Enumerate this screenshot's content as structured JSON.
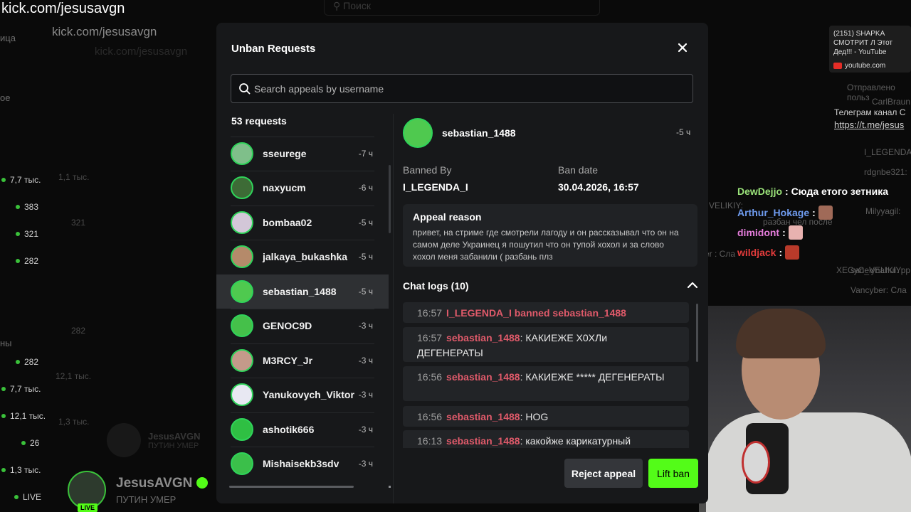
{
  "background": {
    "url_overlay": "kick.com/jesusavgn",
    "url_bar": "kick.com/jesusavgn",
    "url_bar_faint": "kick.com/jesusavgn",
    "search_placeholder": "Поиск",
    "left_labels": [
      "ица",
      "ое",
      "ны"
    ],
    "stats": [
      "7,7 тыс.",
      "383",
      "321",
      "282",
      "282",
      "7,7 тыс.",
      "12,1 тыс.",
      "26",
      "1,3 тыс.",
      "LIVE"
    ],
    "faint_stats": [
      "1,1 тыс.",
      "321",
      "282",
      "12,1 тыс.",
      "1,3 тыс."
    ],
    "channel_name": "JesusAVGN",
    "channel_subtitle": "ПУТИН УМЕР",
    "live_badge": "LIVE",
    "ghost_name": "JesusAVGN",
    "ghost_sub": "ПУТИН УМЕР"
  },
  "modal": {
    "title": "Unban Requests",
    "search_placeholder": "Search appeals by username",
    "request_count": "53 requests",
    "requests": [
      {
        "username": "sseurege",
        "time": "-7 ч",
        "color": "#7fbf8a"
      },
      {
        "username": "naxyucm",
        "time": "-6 ч",
        "color": "#3d6b36"
      },
      {
        "username": "bombaa02",
        "time": "-5 ч",
        "color": "#d3c7d8"
      },
      {
        "username": "jalkaya_bukashka",
        "time": "-5 ч",
        "color": "#b58a6a"
      },
      {
        "username": "sebastian_1488",
        "time": "-5 ч",
        "color": "#4fc94f"
      },
      {
        "username": "GENOC9D",
        "time": "-3 ч",
        "color": "#45c04a"
      },
      {
        "username": "M3RCY_Jr",
        "time": "-3 ч",
        "color": "#c49a8a"
      },
      {
        "username": "Yanukovych_Viktor",
        "time": "-3 ч",
        "color": "#e8e8f2"
      },
      {
        "username": "ashotik666",
        "time": "-3 ч",
        "color": "#2fbf43"
      },
      {
        "username": "Mishaisekb3sdv",
        "time": "-3 ч",
        "color": "#3bbf4a"
      }
    ],
    "selected": {
      "username": "sebastian_1488",
      "time": "-5 ч",
      "banned_by_label": "Banned By",
      "banned_by": "I_LEGENDA_I",
      "ban_date_label": "Ban date",
      "ban_date": "30.04.2026, 16:57",
      "appeal_reason_label": "Appeal reason",
      "appeal_reason": "привет, на стриме где смотрели лагоду и он рассказывал что он на самом деле Украинец я пошутил что он тупой хохол и за слово хохол меня забанили ( разбань плз",
      "chat_logs_label": "Chat logs (10)",
      "logs": [
        {
          "time": "16:57",
          "user": "",
          "text": "I_LEGENDA_I banned sebastian_1488",
          "system": true
        },
        {
          "time": "16:57",
          "user": "sebastian_1488",
          "text": ": КАКИЕЖЕ Х0ХЛи ДЕГЕНЕРАТЫ",
          "system": false
        },
        {
          "time": "16:56",
          "user": "sebastian_1488",
          "text": ": КАКИЕЖЕ ***** ДЕГЕНЕРАТЫ",
          "system": false
        },
        {
          "time": "16:56",
          "user": "sebastian_1488",
          "text": ": HOG",
          "system": false
        },
        {
          "time": "16:13",
          "user": "sebastian_1488",
          "text": ": какойже карикатурный",
          "system": false
        }
      ]
    },
    "reject_label": "Reject appeal",
    "lift_label": "Lift ban"
  },
  "chat": {
    "youtube_card": {
      "title": "(2151) SHAPKA СМОТРИТ Л Этот Дед!!! - YouTube",
      "source": "youtube.com"
    },
    "faint_lines": [
      "Отправлено польз",
      "CarlBraun",
      "Телеграм канал С",
      "https://t.me/jesus",
      "I_LEGENDA",
      "rdgnbe321:",
      "Milyyagil:",
      "разбан чел после",
      "XECyC_VELIKIY: р",
      "sanelynahui: р",
      "Vancyber: Сла",
      "VELIKIY: ",
      "er : Сла"
    ],
    "messages": [
      {
        "user": "DewDejjo",
        "text": ": Сюда етого зетника",
        "color": "#9be37a"
      },
      {
        "user": "Arthur_Hokage",
        "text": ":",
        "color": "#6f9cf0"
      },
      {
        "user": "dimidont",
        "text": ":",
        "color": "#e57ddb"
      },
      {
        "user": "wildjack",
        "text": ":",
        "color": "#e23b3b"
      }
    ]
  },
  "colors": {
    "accent": "#53fc18",
    "log_user": "#e05a6a",
    "avatar_ring": "#2fd45a"
  }
}
